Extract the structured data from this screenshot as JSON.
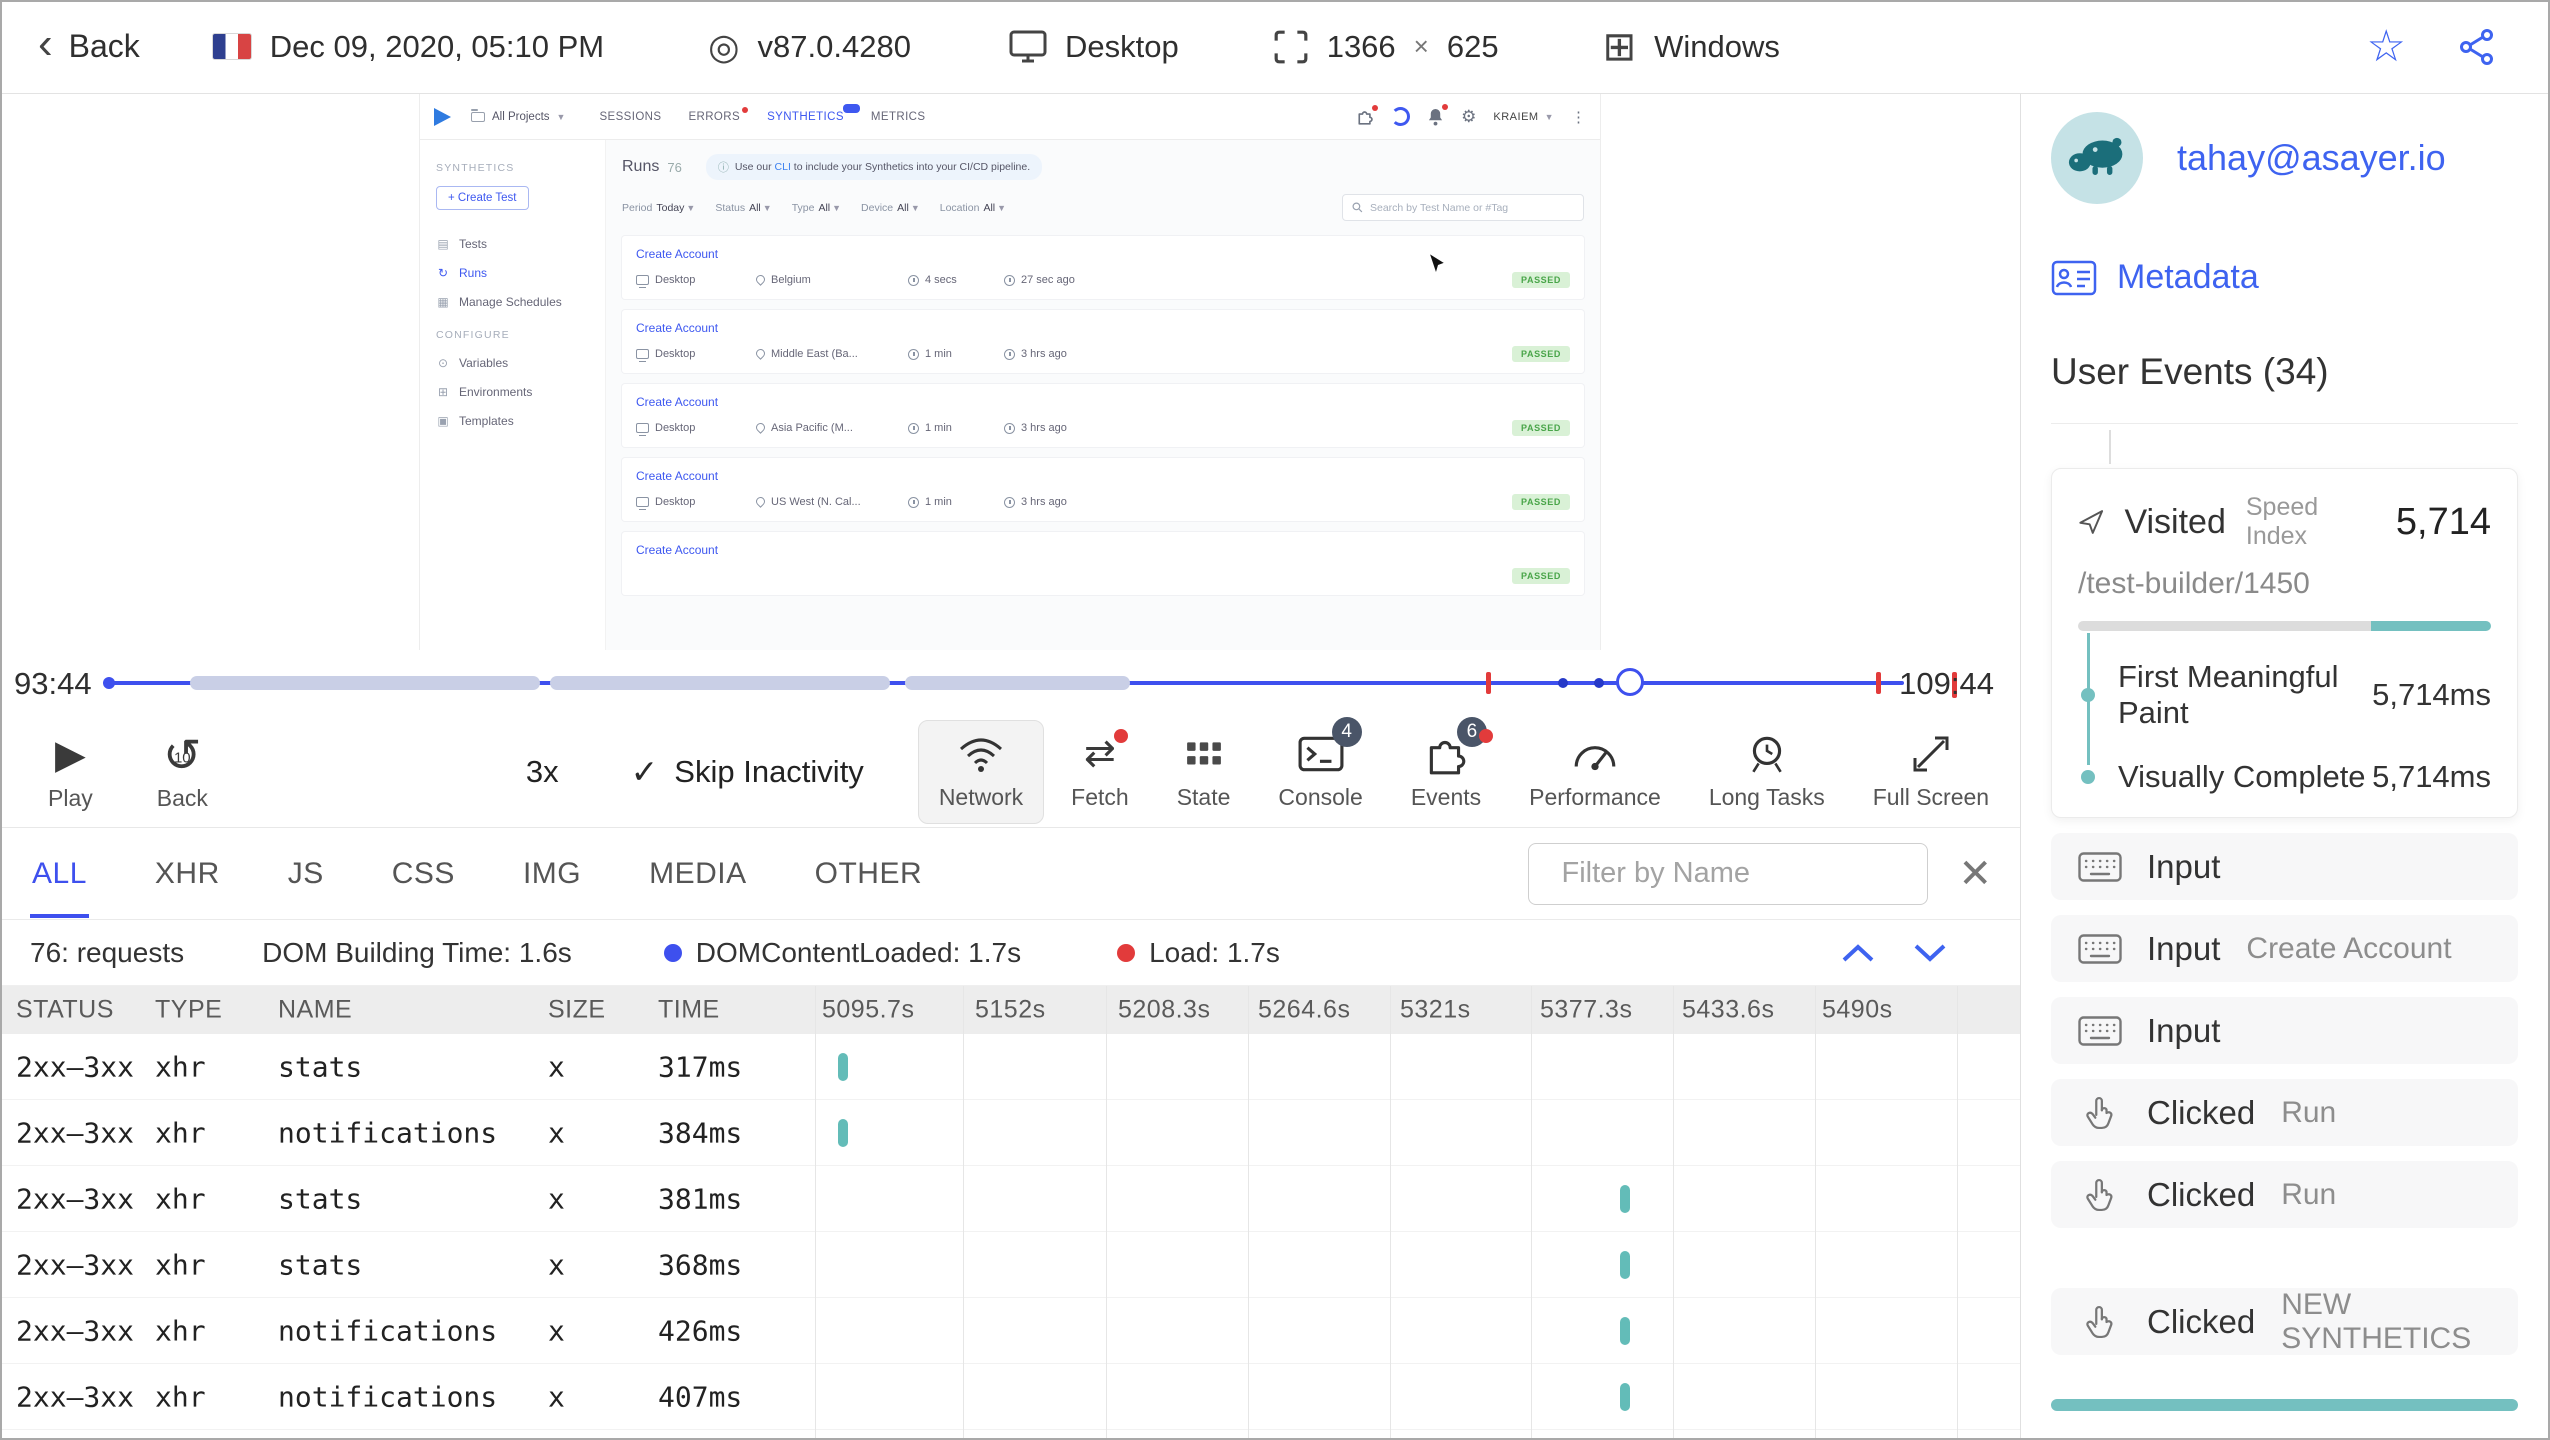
{
  "topbar": {
    "back": "Back",
    "date": "Dec 09, 2020, 05:10 PM",
    "version": "v87.0.4280",
    "device": "Desktop",
    "res_w": "1366",
    "res_x": "×",
    "res_h": "625",
    "os": "Windows"
  },
  "app": {
    "project": "All Projects",
    "tabs": {
      "sessions": "SESSIONS",
      "errors": "ERRORS",
      "synthetics": "SYNTHETICS",
      "metrics": "METRICS"
    },
    "user": "KRAIEM",
    "side": {
      "synthetics_header": "SYNTHETICS",
      "create_test": "+ Create Test",
      "tests": "Tests",
      "runs": "Runs",
      "schedules": "Manage Schedules",
      "configure_header": "CONFIGURE",
      "variables": "Variables",
      "environments": "Environments",
      "templates": "Templates"
    },
    "main": {
      "title": "Runs",
      "count": "76",
      "banner_info": "ⓘ",
      "banner_prefix": "Use our ",
      "banner_cli": "CLI",
      "banner_suffix": " to include your Synthetics into your CI/CD pipeline.",
      "filters": [
        {
          "label": "Period",
          "value": "Today"
        },
        {
          "label": "Status",
          "value": "All"
        },
        {
          "label": "Type",
          "value": "All"
        },
        {
          "label": "Device",
          "value": "All"
        },
        {
          "label": "Location",
          "value": "All"
        }
      ],
      "search_placeholder": "Search by Test Name or #Tag",
      "runs": [
        {
          "name": "Create Account",
          "device": "Desktop",
          "location": "Belgium",
          "duration": "4 secs",
          "ago": "27 sec ago",
          "status": "PASSED"
        },
        {
          "name": "Create Account",
          "device": "Desktop",
          "location": "Middle East (Ba...",
          "duration": "1 min",
          "ago": "3 hrs ago",
          "status": "PASSED"
        },
        {
          "name": "Create Account",
          "device": "Desktop",
          "location": "Asia Pacific (M...",
          "duration": "1 min",
          "ago": "3 hrs ago",
          "status": "PASSED"
        },
        {
          "name": "Create Account",
          "device": "Desktop",
          "location": "US West (N. Cal...",
          "duration": "1 min",
          "ago": "3 hrs ago",
          "status": "PASSED"
        },
        {
          "name": "Create Account",
          "status": "PASSED"
        }
      ]
    }
  },
  "timeline": {
    "current": "93:44",
    "total": "109:44"
  },
  "controls": {
    "play": "Play",
    "back": "Back",
    "back_num": "10",
    "speed": "3x",
    "skip": "Skip Inactivity",
    "check": "✓",
    "network": "Network",
    "fetch": "Fetch",
    "state": "State",
    "console": "Console",
    "console_count": "4",
    "events": "Events",
    "events_count": "6",
    "performance": "Performance",
    "long_tasks": "Long Tasks",
    "full_screen": "Full Screen"
  },
  "network": {
    "tabs": [
      "ALL",
      "XHR",
      "JS",
      "CSS",
      "IMG",
      "MEDIA",
      "OTHER"
    ],
    "filter_placeholder": "Filter by Name",
    "requests": "76: requests",
    "dom_building": "DOM Building Time: 1.6s",
    "dcl": "DOMContentLoaded: 1.7s",
    "load": "Load: 1.7s",
    "columns": {
      "status": "STATUS",
      "type": "TYPE",
      "name": "NAME",
      "size": "SIZE",
      "time": "TIME"
    },
    "time_cols": [
      "5095.7s",
      "5152s",
      "5208.3s",
      "5264.6s",
      "5321s",
      "5377.3s",
      "5433.6s",
      "5490s"
    ],
    "rows": [
      {
        "status": "2xx–3xx",
        "type": "xhr",
        "name": "stats",
        "size": "x",
        "time": "317ms"
      },
      {
        "status": "2xx–3xx",
        "type": "xhr",
        "name": "notifications",
        "size": "x",
        "time": "384ms"
      },
      {
        "status": "2xx–3xx",
        "type": "xhr",
        "name": "stats",
        "size": "x",
        "time": "381ms"
      },
      {
        "status": "2xx–3xx",
        "type": "xhr",
        "name": "stats",
        "size": "x",
        "time": "368ms"
      },
      {
        "status": "2xx–3xx",
        "type": "xhr",
        "name": "notifications",
        "size": "x",
        "time": "426ms"
      },
      {
        "status": "2xx–3xx",
        "type": "xhr",
        "name": "notifications",
        "size": "x",
        "time": "407ms"
      }
    ]
  },
  "user_panel": {
    "email": "tahay@asayer.io",
    "metadata": "Metadata",
    "events_title": "User Events (34)",
    "visited": {
      "label": "Visited",
      "speed_index_label": "Speed Index",
      "speed_index": "5,714",
      "path": "/test-builder/1450",
      "fmp_label": "First Meaningful Paint",
      "fmp_value": "5,714ms",
      "vc_label": "Visually Complete",
      "vc_value": "5,714ms"
    },
    "events": [
      {
        "label": "Input",
        "value": ""
      },
      {
        "label": "Input",
        "value": "Create Account"
      },
      {
        "label": "Input",
        "value": ""
      },
      {
        "label": "Clicked",
        "value": "Run"
      },
      {
        "label": "Clicked",
        "value": "Run"
      },
      {
        "label": "Clicked",
        "value": "NEW SYNTHETICS"
      }
    ]
  }
}
